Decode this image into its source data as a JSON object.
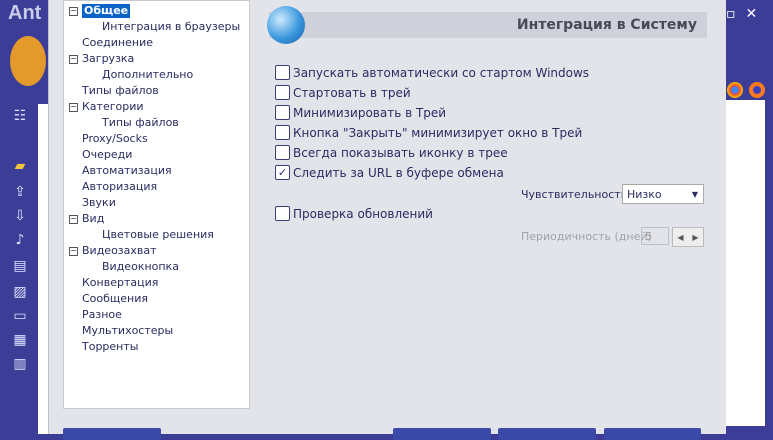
{
  "app": {
    "title_partial": "Ant I"
  },
  "tree": {
    "items": [
      {
        "label": "Общее",
        "level": 0,
        "expand": true,
        "selected": true
      },
      {
        "label": "Интеграция в браузеры",
        "level": 1
      },
      {
        "label": "Соединение",
        "level": 0
      },
      {
        "label": "Загрузка",
        "level": 0,
        "expand": true
      },
      {
        "label": "Дополнительно",
        "level": 1
      },
      {
        "label": "Типы файлов",
        "level": 0
      },
      {
        "label": "Категории",
        "level": 0,
        "expand": true
      },
      {
        "label": "Типы файлов",
        "level": 1
      },
      {
        "label": "Proxy/Socks",
        "level": 0
      },
      {
        "label": "Очереди",
        "level": 0
      },
      {
        "label": "Автоматизация",
        "level": 0
      },
      {
        "label": "Авторизация",
        "level": 0
      },
      {
        "label": "Звуки",
        "level": 0
      },
      {
        "label": "Вид",
        "level": 0,
        "expand": true
      },
      {
        "label": "Цветовые решения",
        "level": 1
      },
      {
        "label": "Видеозахват",
        "level": 0,
        "expand": true
      },
      {
        "label": "Видеокнопка",
        "level": 1
      },
      {
        "label": "Конвертация",
        "level": 0
      },
      {
        "label": "Сообщения",
        "level": 0
      },
      {
        "label": "Разное",
        "level": 0
      },
      {
        "label": "Мультихостеры",
        "level": 0
      },
      {
        "label": "Торренты",
        "level": 0
      }
    ]
  },
  "header": {
    "title": "Интеграция в Систему"
  },
  "options": [
    {
      "label": "Запускать автоматически со стартом Windows",
      "checked": false
    },
    {
      "label": "Стартовать в трей",
      "checked": false
    },
    {
      "label": "Минимизировать в Трей",
      "checked": false
    },
    {
      "label": "Кнопка \"Закрыть\" минимизирует окно в Трей",
      "checked": false
    },
    {
      "label": "Всегда показывать иконку в трее",
      "checked": false
    },
    {
      "label": "Следить за URL в буфере обмена",
      "checked": true
    }
  ],
  "sensitivity": {
    "label": "Чувствительность",
    "value": "Низко"
  },
  "updates": {
    "label": "Проверка обновлений",
    "checked": false
  },
  "period": {
    "label": "Периодичность (дней)",
    "value": "5"
  },
  "colors": {
    "accent": "#0a64c8",
    "app_bg": "#3b3d96"
  }
}
